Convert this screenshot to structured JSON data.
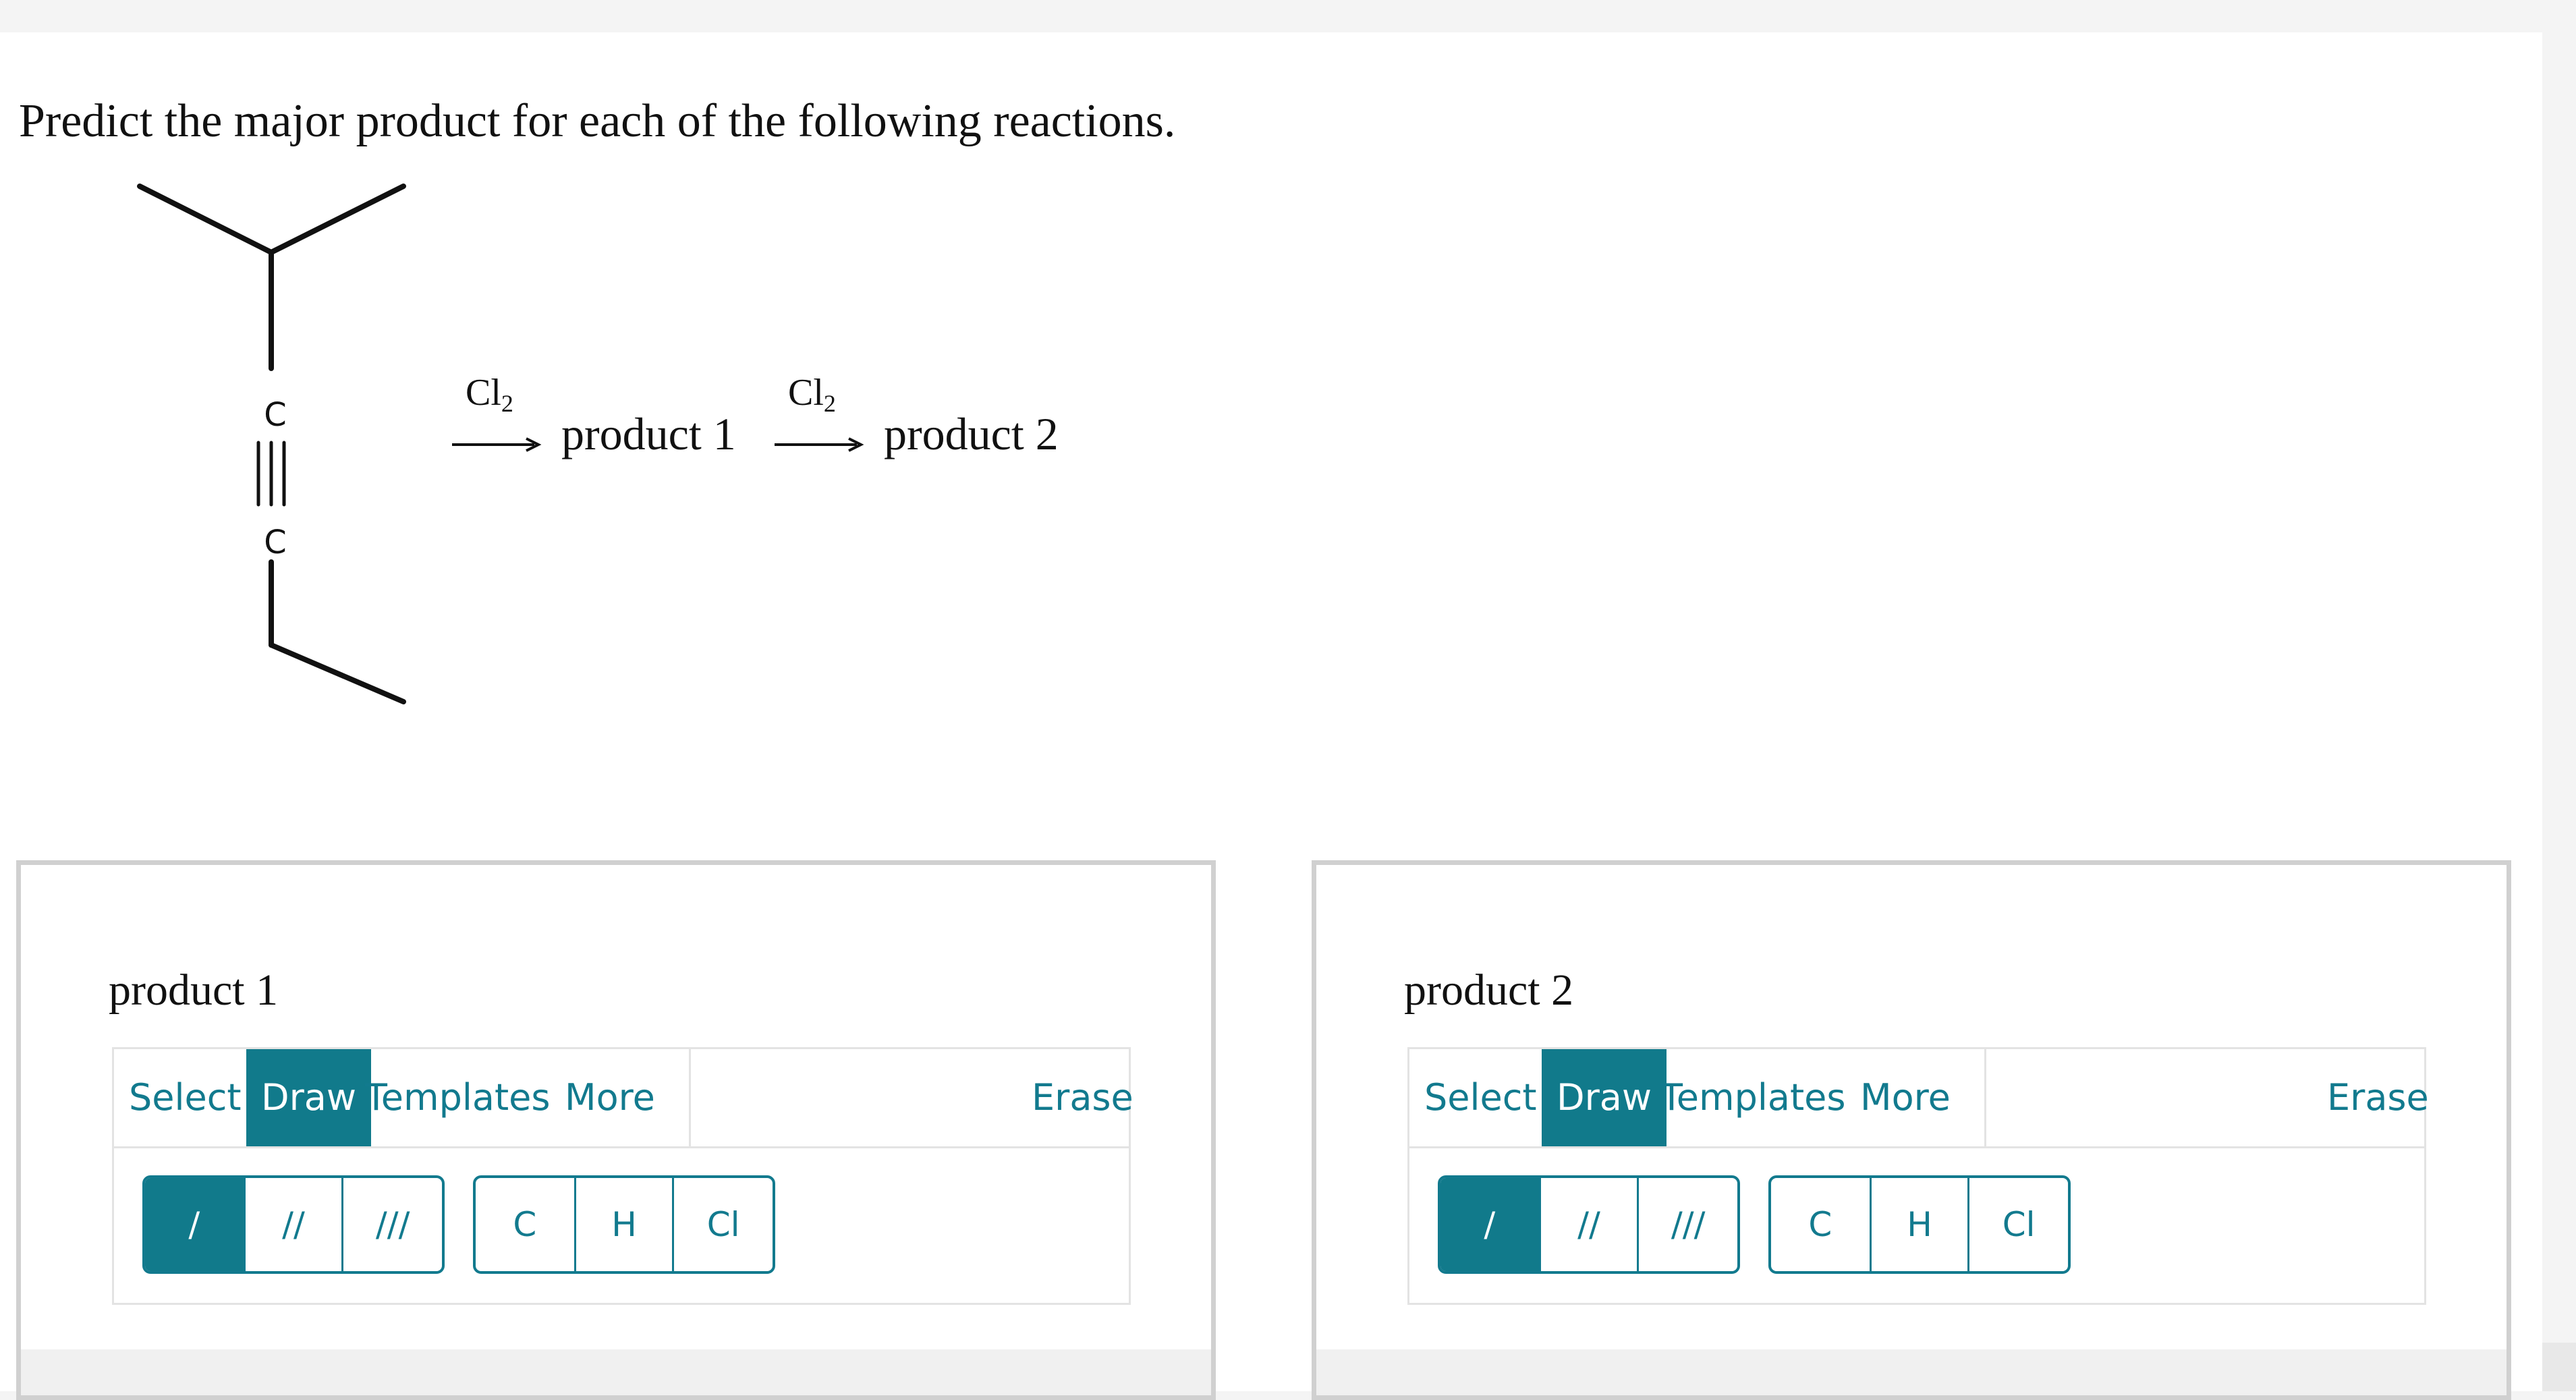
{
  "question": "Predict the major product for each of the following reactions.",
  "reaction": {
    "atom_c_top": "C",
    "atom_c_bottom": "C",
    "reagent_1": "Cl",
    "reagent_1_sub": "2",
    "intermediate": "product 1",
    "reagent_2": "Cl",
    "reagent_2_sub": "2",
    "final": "product 2"
  },
  "panels": [
    {
      "title": "product 1",
      "toolbar": {
        "select": "Select",
        "draw": "Draw",
        "templates": "Templates",
        "more": "More",
        "erase": "Erase"
      },
      "bonds": [
        "/",
        "//",
        "///"
      ],
      "atoms": [
        "C",
        "H",
        "Cl"
      ]
    },
    {
      "title": "product 2",
      "toolbar": {
        "select": "Select",
        "draw": "Draw",
        "templates": "Templates",
        "more": "More",
        "erase": "Erase"
      },
      "bonds": [
        "/",
        "//",
        "///"
      ],
      "atoms": [
        "C",
        "H",
        "Cl"
      ]
    }
  ],
  "colors": {
    "accent": "#117a8b",
    "border": "#d0d0d0"
  }
}
